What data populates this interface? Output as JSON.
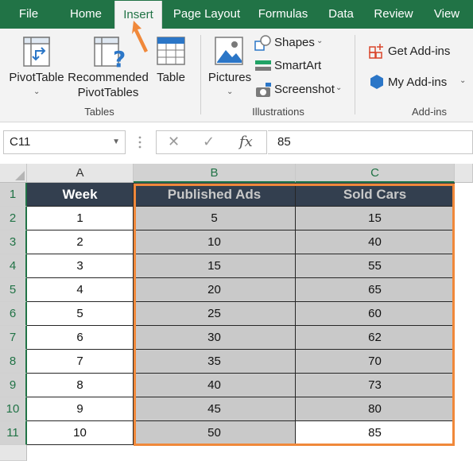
{
  "menu": {
    "tabs": [
      "File",
      "Home",
      "Insert",
      "Page Layout",
      "Formulas",
      "Data",
      "Review",
      "View"
    ],
    "active_tab": "Insert"
  },
  "ribbon": {
    "tables": {
      "pivot_table": "PivotTable",
      "recommended_line1": "Recommended",
      "recommended_line2": "PivotTables",
      "table": "Table",
      "group_label": "Tables"
    },
    "illustrations": {
      "pictures": "Pictures",
      "shapes": "Shapes",
      "smartart": "SmartArt",
      "screenshot": "Screenshot",
      "group_label": "Illustrations"
    },
    "addins": {
      "get_addins": "Get Add-ins",
      "my_addins": "My Add-ins",
      "group_label": "Add-ins"
    }
  },
  "formula_bar": {
    "name_box": "C11",
    "fx": "fx",
    "value": "85"
  },
  "grid": {
    "columns": [
      "A",
      "B",
      "C"
    ],
    "selected_columns": [
      "B",
      "C"
    ],
    "row_numbers": [
      "1",
      "2",
      "3",
      "4",
      "5",
      "6",
      "7",
      "8",
      "9",
      "10",
      "11"
    ],
    "headers": [
      "Week",
      "Published Ads",
      "Sold Cars"
    ],
    "rows": [
      [
        "1",
        "5",
        "15"
      ],
      [
        "2",
        "10",
        "40"
      ],
      [
        "3",
        "15",
        "55"
      ],
      [
        "4",
        "20",
        "65"
      ],
      [
        "5",
        "25",
        "60"
      ],
      [
        "6",
        "30",
        "62"
      ],
      [
        "7",
        "35",
        "70"
      ],
      [
        "8",
        "40",
        "73"
      ],
      [
        "9",
        "45",
        "80"
      ],
      [
        "10",
        "50",
        "85"
      ]
    ]
  },
  "colors": {
    "excel_green": "#217346",
    "header_fill": "#333f4f",
    "selection_fill": "#c9c9c9",
    "selection_outline": "#f0883a"
  }
}
